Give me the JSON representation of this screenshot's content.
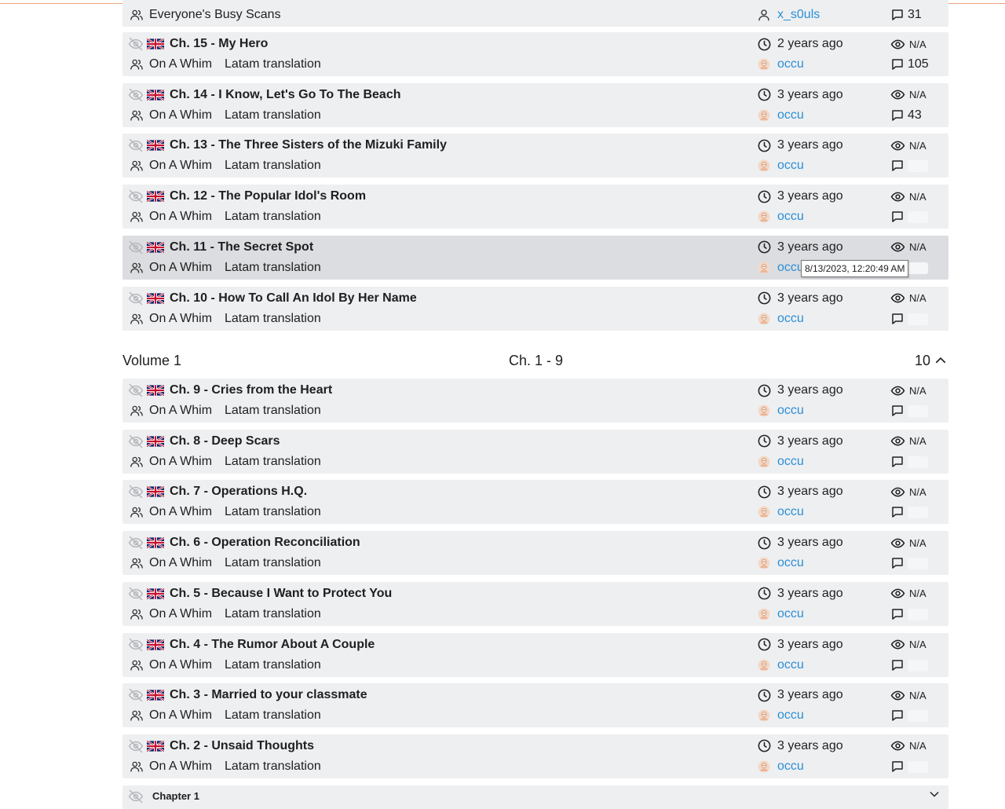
{
  "top_row": {
    "group": "Everyone's Busy Scans",
    "uploader": "x_s0uls",
    "comments": "31"
  },
  "chapters_top": [
    {
      "title": "Ch. 15 - My Hero",
      "group1": "On A Whim",
      "group2": "Latam translation",
      "time": "2 years ago",
      "uploader": "occu",
      "views": "N/A",
      "comments": "105"
    },
    {
      "title": "Ch. 14 - I Know, Let's Go To The Beach",
      "group1": "On A Whim",
      "group2": "Latam translation",
      "time": "3 years ago",
      "uploader": "occu",
      "views": "N/A",
      "comments": "43"
    },
    {
      "title": "Ch. 13 - The Three Sisters of the Mizuki Family",
      "group1": "On A Whim",
      "group2": "Latam translation",
      "time": "3 years ago",
      "uploader": "occu",
      "views": "N/A",
      "comments": ""
    },
    {
      "title": "Ch. 12 - The Popular Idol's Room",
      "group1": "On A Whim",
      "group2": "Latam translation",
      "time": "3 years ago",
      "uploader": "occu",
      "views": "N/A",
      "comments": ""
    },
    {
      "title": "Ch. 11 - The Secret Spot",
      "group1": "On A Whim",
      "group2": "Latam translation",
      "time": "3 years ago",
      "uploader": "occu",
      "views": "N/A",
      "comments": ""
    },
    {
      "title": "Ch. 10 - How To Call An Idol By Her Name",
      "group1": "On A Whim",
      "group2": "Latam translation",
      "time": "3 years ago",
      "uploader": "occu",
      "views": "N/A",
      "comments": ""
    }
  ],
  "tooltip": "8/13/2023, 12:20:49 AM",
  "volume": {
    "label": "Volume 1",
    "range": "Ch. 1 - 9",
    "count": "10"
  },
  "chapters_vol1": [
    {
      "title": "Ch. 9 - Cries from the Heart",
      "group1": "On A Whim",
      "group2": "Latam translation",
      "time": "3 years ago",
      "uploader": "occu",
      "views": "N/A",
      "comments": ""
    },
    {
      "title": "Ch. 8 - Deep Scars",
      "group1": "On A Whim",
      "group2": "Latam translation",
      "time": "3 years ago",
      "uploader": "occu",
      "views": "N/A",
      "comments": ""
    },
    {
      "title": "Ch. 7 - Operations H.Q.",
      "group1": "On A Whim",
      "group2": "Latam translation",
      "time": "3 years ago",
      "uploader": "occu",
      "views": "N/A",
      "comments": ""
    },
    {
      "title": "Ch. 6 - Operation Reconciliation",
      "group1": "On A Whim",
      "group2": "Latam translation",
      "time": "3 years ago",
      "uploader": "occu",
      "views": "N/A",
      "comments": ""
    },
    {
      "title": "Ch. 5 - Because I Want to Protect You",
      "group1": "On A Whim",
      "group2": "Latam translation",
      "time": "3 years ago",
      "uploader": "occu",
      "views": "N/A",
      "comments": ""
    },
    {
      "title": "Ch. 4 - The Rumor About A Couple",
      "group1": "On A Whim",
      "group2": "Latam translation",
      "time": "3 years ago",
      "uploader": "occu",
      "views": "N/A",
      "comments": ""
    },
    {
      "title": "Ch. 3 - Married to your classmate",
      "group1": "On A Whim",
      "group2": "Latam translation",
      "time": "3 years ago",
      "uploader": "occu",
      "views": "N/A",
      "comments": ""
    },
    {
      "title": "Ch. 2 - Unsaid Thoughts",
      "group1": "On A Whim",
      "group2": "Latam translation",
      "time": "3 years ago",
      "uploader": "occu",
      "views": "N/A",
      "comments": ""
    }
  ],
  "last_chapter": {
    "title": "Chapter 1"
  }
}
